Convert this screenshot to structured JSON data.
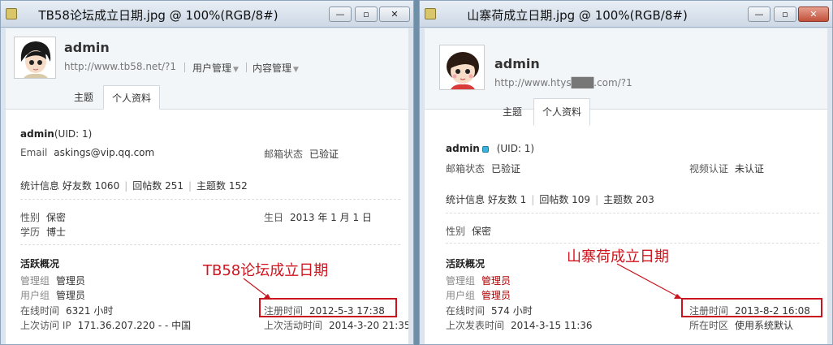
{
  "window_left": {
    "title": "TB58论坛成立日期.jpg @ 100%(RGB/8#)",
    "controls": {
      "minimize": "—",
      "maximize": "▫",
      "close": "✕"
    },
    "profile": {
      "username": "admin",
      "url": "http://www.tb58.net/?1",
      "menus": [
        "用户管理",
        "内容管理"
      ],
      "tabs": [
        "主题",
        "个人资料"
      ]
    },
    "uid_line": {
      "name": "admin",
      "uid": "(UID: 1)"
    },
    "email": {
      "label": "Email",
      "value": "askings@vip.qq.com"
    },
    "mail_status": {
      "label": "邮箱状态",
      "value": "已验证"
    },
    "stats": {
      "label": "统计信息",
      "items": [
        "好友数 1060",
        "回帖数 251",
        "主题数 152"
      ]
    },
    "gender": {
      "label": "性别",
      "value": "保密"
    },
    "birthday": {
      "label": "生日",
      "value": "2013 年 1 月 1 日"
    },
    "education": {
      "label": "学历",
      "value": "博士"
    },
    "activity": {
      "heading": "活跃概况",
      "admin_group": {
        "label": "管理组",
        "value": "管理员"
      },
      "user_group": {
        "label": "用户组",
        "value": "管理员"
      },
      "online": {
        "label": "在线时间",
        "value": "6321 小时"
      },
      "last_visit_ip": {
        "label": "上次访问 IP",
        "value": "171.36.207.220 - - 中国"
      },
      "register": {
        "label": "注册时间",
        "value": "2012-5-3 17:38"
      },
      "last_active": {
        "label": "上次活动时间",
        "value": "2014-3-20 21:35"
      }
    },
    "annotation": "TB58论坛成立日期"
  },
  "window_right": {
    "title": "山寨荷成立日期.jpg @ 100%(RGB/8#)",
    "controls": {
      "minimize": "—",
      "maximize": "▫",
      "close": "✕"
    },
    "profile": {
      "username": "admin",
      "url": "http://www.htys███.com/?1",
      "tabs": [
        "主题",
        "个人资料"
      ]
    },
    "uid_line": {
      "name": "admin",
      "uid": "(UID: 1)"
    },
    "mail_status": {
      "label": "邮箱状态",
      "value": "已验证"
    },
    "video_auth": {
      "label": "视频认证",
      "value": "未认证"
    },
    "stats": {
      "label": "统计信息",
      "items": [
        "好友数 1",
        "回帖数 109",
        "主题数 203"
      ]
    },
    "gender": {
      "label": "性别",
      "value": "保密"
    },
    "activity": {
      "heading": "活跃概况",
      "admin_group": {
        "label": "管理组",
        "value": "管理员"
      },
      "user_group": {
        "label": "用户组",
        "value": "管理员"
      },
      "online": {
        "label": "在线时间",
        "value": "574 小时"
      },
      "last_post": {
        "label": "上次发表时间",
        "value": "2014-3-15 11:36"
      },
      "register": {
        "label": "注册时间",
        "value": "2013-8-2 16:08"
      },
      "timezone": {
        "label": "所在时区",
        "value": "使用系统默认"
      }
    },
    "annotation": "山寨荷成立日期"
  },
  "colors": {
    "annotation_red": "#d0141e",
    "group_red": "#a00000",
    "background": "#6e8fa8"
  },
  "icons": [
    "app-icon",
    "avatar-boy-icon",
    "avatar-girl-icon",
    "online-status-icon",
    "dropdown-arrow-icon"
  ]
}
